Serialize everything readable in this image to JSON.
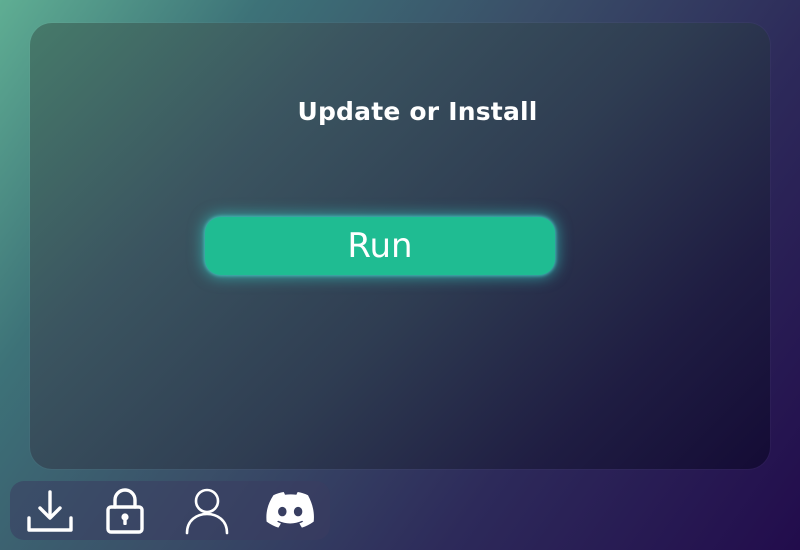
{
  "main": {
    "title": "Update or Install",
    "run_label": "Run"
  },
  "dock": {
    "items": [
      {
        "id": "download",
        "icon": "download-icon"
      },
      {
        "id": "lock",
        "icon": "lock-icon"
      },
      {
        "id": "account",
        "icon": "user-icon"
      },
      {
        "id": "discord",
        "icon": "discord-icon"
      }
    ]
  },
  "colors": {
    "accent": "#1fbc92",
    "glow": "#34d7cd",
    "text": "#ffffff"
  }
}
